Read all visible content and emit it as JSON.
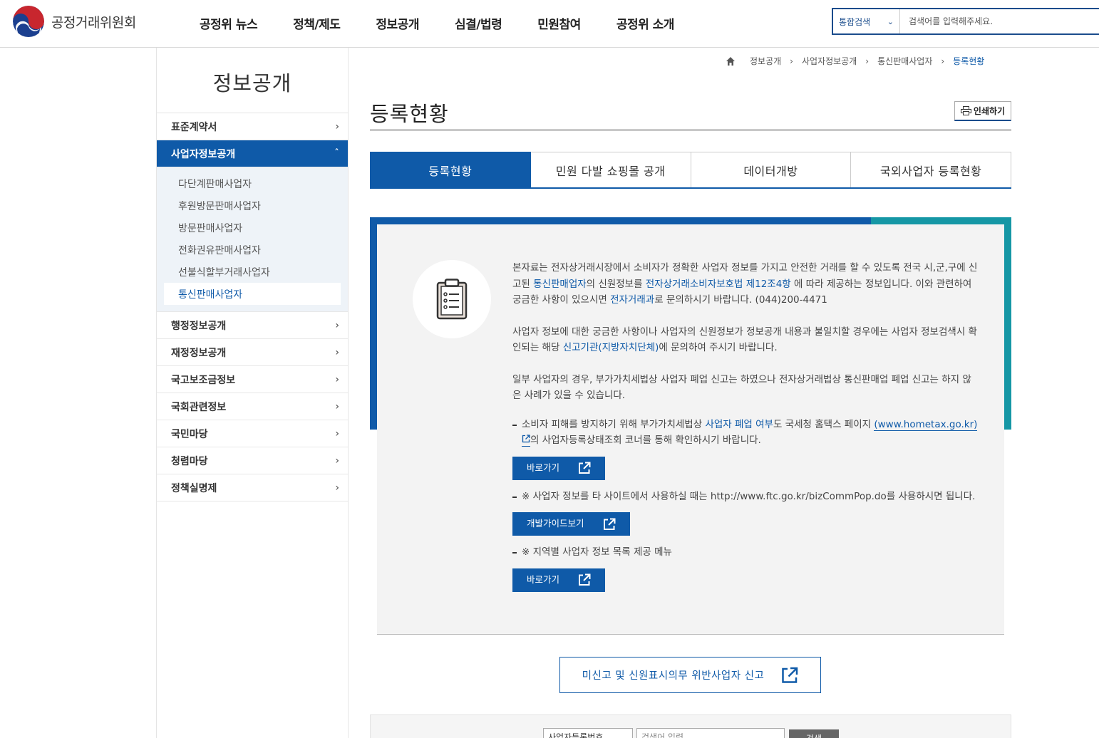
{
  "header": {
    "logo_text": "공정거래위원회",
    "nav": [
      "공정위 뉴스",
      "정책/제도",
      "정보공개",
      "심결/법령",
      "민원참여",
      "공정위 소개"
    ],
    "search_select": "통합검색",
    "search_placeholder": "검색어를 입력해주세요."
  },
  "sidebar": {
    "title": "정보공개",
    "items": [
      {
        "label": "표준계약서"
      },
      {
        "label": "사업자정보공개",
        "active": true
      },
      {
        "label": "행정정보공개"
      },
      {
        "label": "재정정보공개"
      },
      {
        "label": "국고보조금정보"
      },
      {
        "label": "국회관련정보"
      },
      {
        "label": "국민마당"
      },
      {
        "label": "청렴마당"
      },
      {
        "label": "정책실명제"
      }
    ],
    "submenu": [
      "다단계판매사업자",
      "후원방문판매사업자",
      "방문판매사업자",
      "전화권유판매사업자",
      "선불식할부거래사업자",
      "통신판매사업자"
    ]
  },
  "breadcrumb": [
    "정보공개",
    "사업자정보공개",
    "통신판매사업자",
    "등록현황"
  ],
  "page_title": "등록현황",
  "print_label": "인쇄하기",
  "tabs": [
    "등록현황",
    "민원 다발 쇼핑몰 공개",
    "데이터개방",
    "국외사업자 등록현황"
  ],
  "info": {
    "p1_a": "본자료는 전자상거래시장에서 소비자가 정확한 사업자 정보를 가지고 안전한 거래를 할 수 있도록 전국 시,군,구에 신고된 ",
    "p1_link1": "통신판매업자",
    "p1_b": "의 신원정보를 ",
    "p1_link2": "전자상거래소비자보호법 제12조4항",
    "p1_c": " 에 따라 제공하는 정보입니다. 이와 관련하여 궁금한 사항이 있으시면 ",
    "p1_link3": "전자거래과",
    "p1_d": "로 문의하시기 바랍니다. (044)200-4471",
    "p2_a": "사업자 정보에 대한 궁금한 사항이나 사업자의 신원정보가 정보공개 내용과 불일치할 경우에는 사업자 정보검색시 확인되는 해당 ",
    "p2_link": "신고기관(지방자치단체)",
    "p2_b": "에 문의하여 주시기 바랍니다.",
    "p3": "일부 사업자의 경우, 부가가치세법상 사업자 폐업 신고는 하였으나 전자상거래법상 통신판매업 폐업 신고는 하지 않은 사례가 있을 수 있습니다.",
    "b1_a": "소비자 피해를 방지하기 위해 부가가치세법상 ",
    "b1_link1": "사업자 폐업 여부",
    "b1_b": "도 국세청 홈택스 페이지 ",
    "b1_link2": "(www.hometax.go.kr)",
    "b1_c": "의 사업자등록상태조회 코너를 통해 확인하시기 바랍니다.",
    "btn1": "바로가기",
    "b2": "※ 사업자 정보를 타 사이트에서 사용하실 때는 http://www.ftc.go.kr/bizCommPop.do를 사용하시면 됩니다.",
    "btn2": "개발가이드보기",
    "b3": "※ 지역별 사업자 정보 목록 제공 메뉴",
    "btn3": "바로가기"
  },
  "report_label": "미신고 및 신원표시의무 위반사업자 신고",
  "bottom_search": {
    "select": "사업자등록번호",
    "placeholder": "검색어 입력",
    "button": "검색"
  },
  "colors": {
    "primary": "#0f5aa8",
    "teal": "#1597a5",
    "info_bg": "#f3f3f3"
  }
}
